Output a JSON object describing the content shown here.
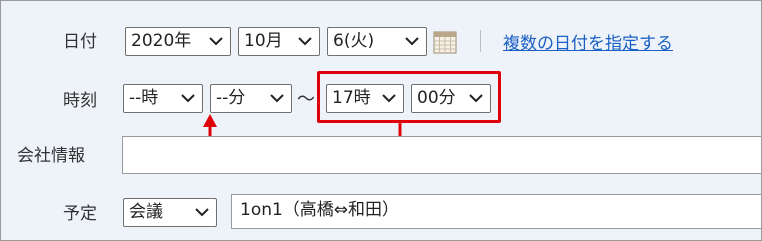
{
  "date_row": {
    "label": "日付",
    "year": "2020年",
    "month": "10月",
    "day": "6(火)",
    "calendar_icon": "calendar-icon",
    "multi_date_link": "複数の日付を指定する"
  },
  "time_row": {
    "label": "時刻",
    "start_hour": "--時",
    "start_minute": "--分",
    "separator": "〜",
    "end_hour": "17時",
    "end_minute": "00分"
  },
  "company_row": {
    "label": "会社情報",
    "value": ""
  },
  "schedule_row": {
    "label": "予定",
    "type": "会議",
    "title": "1on1（高橋⇔和田）"
  },
  "annotation": {
    "highlight_color": "#e0000a",
    "arrow_meaning": "end-time-to-start-time"
  }
}
